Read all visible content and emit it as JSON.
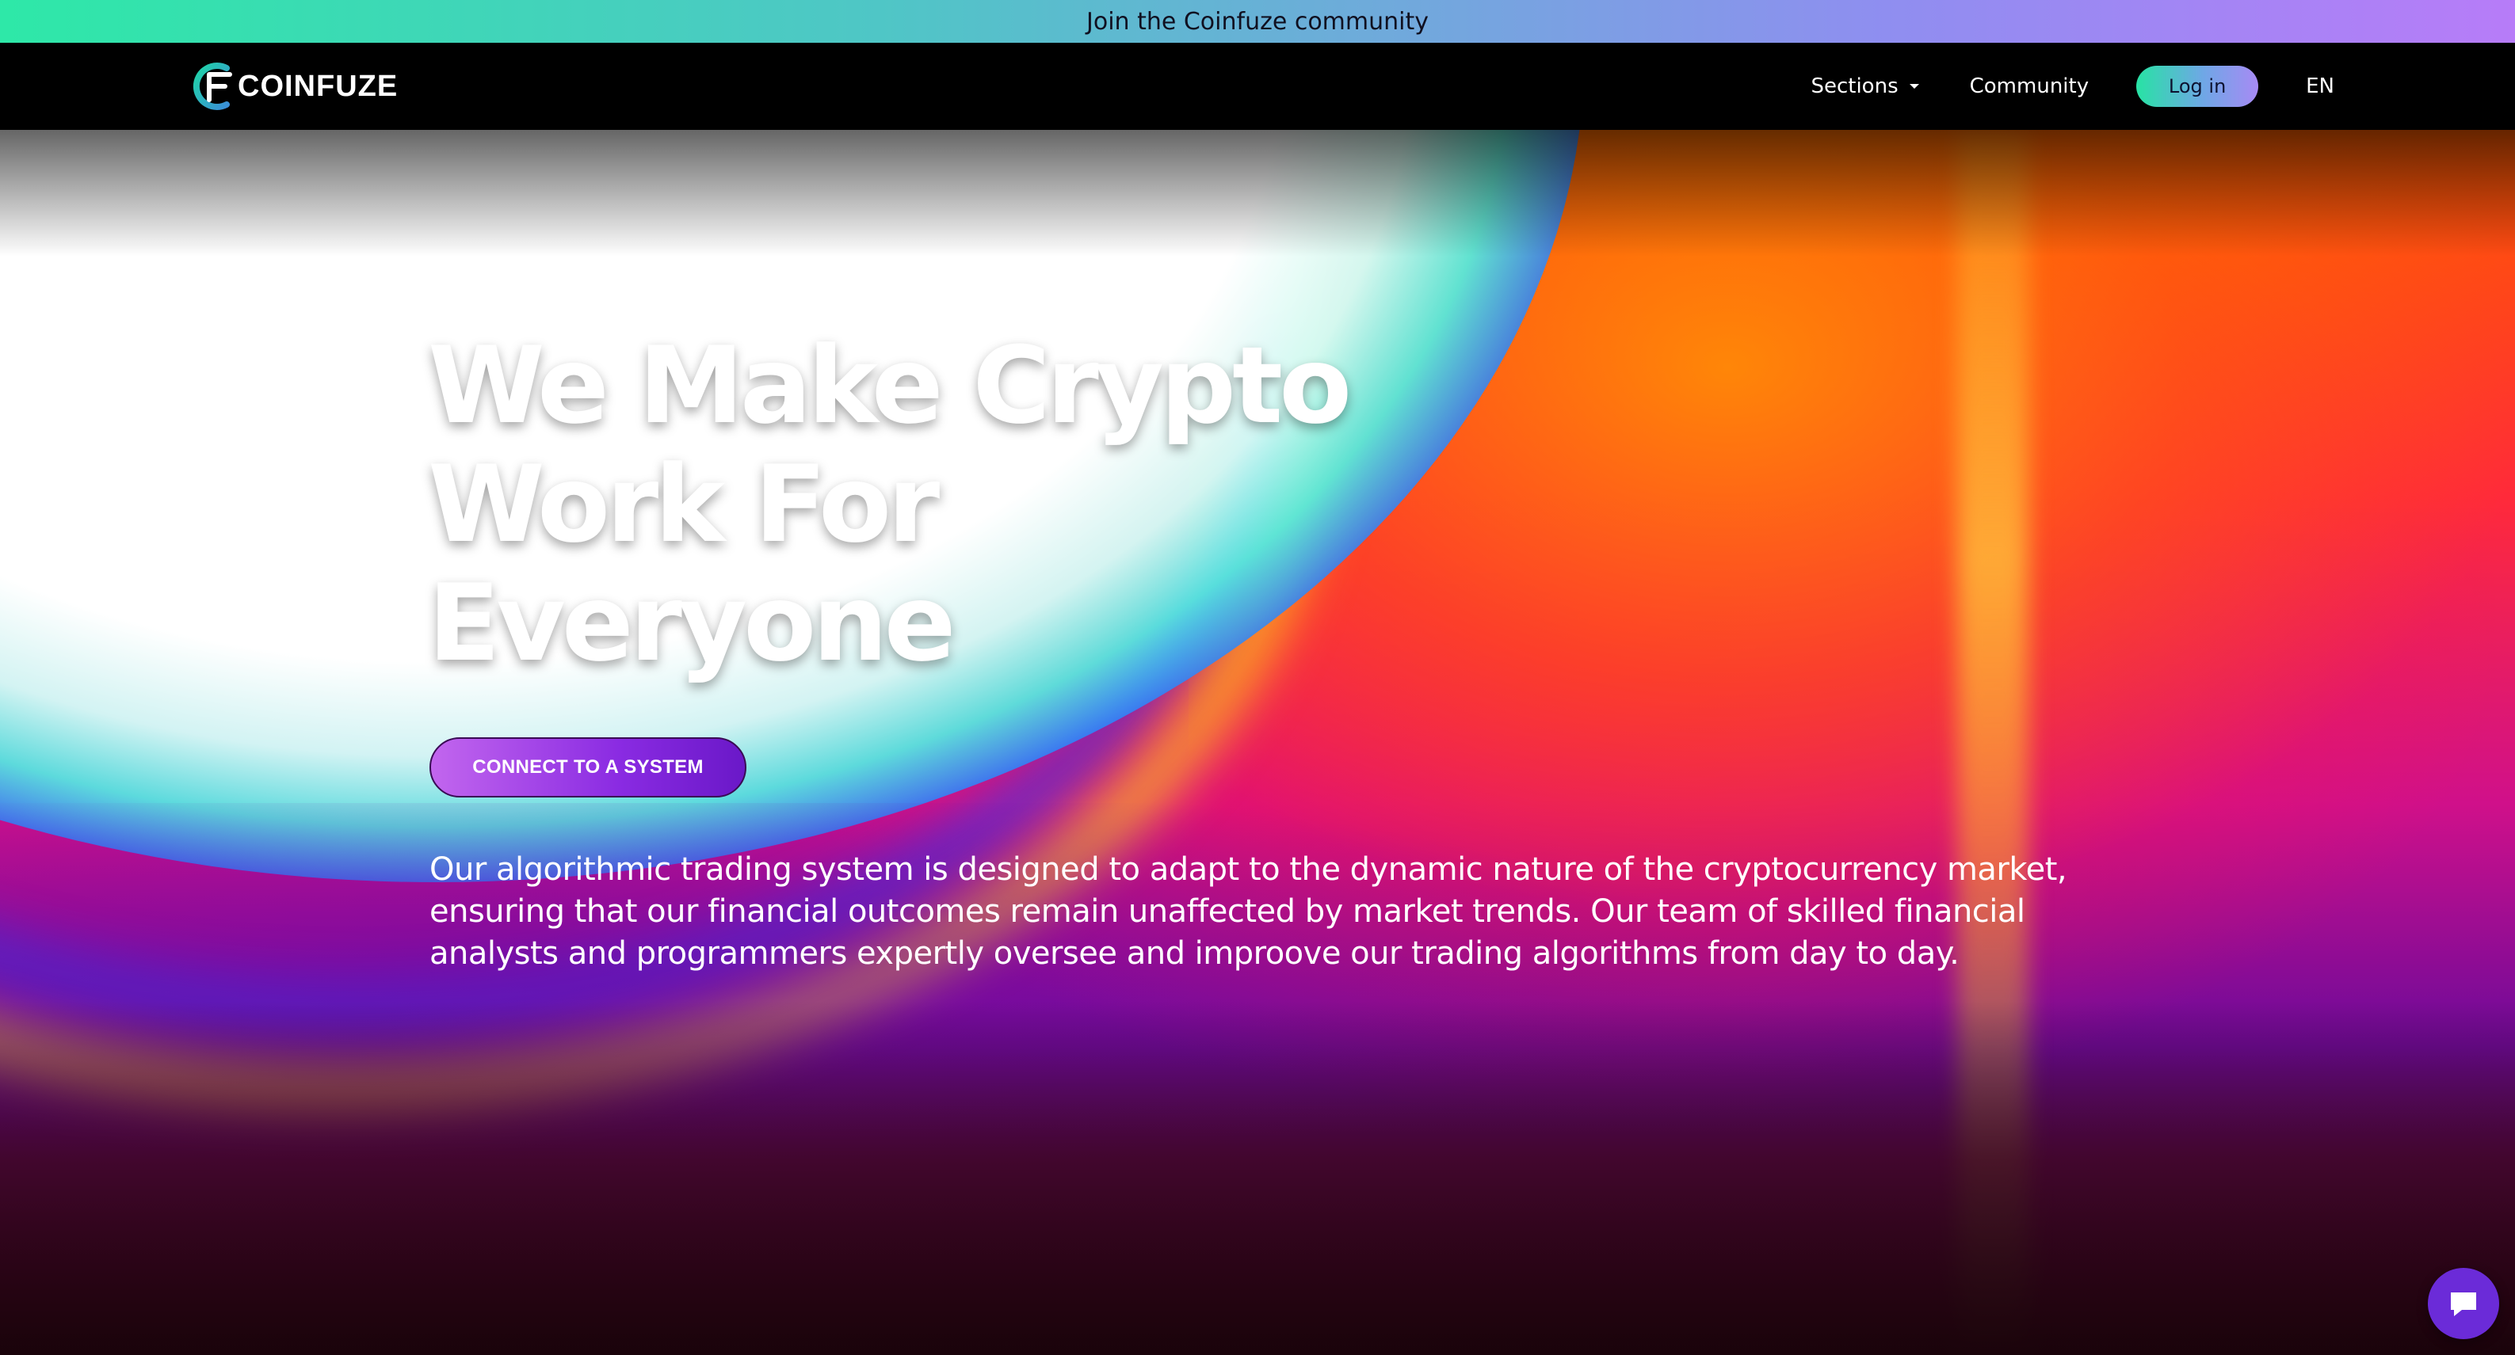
{
  "banner": {
    "text": "Join the Coinfuze community"
  },
  "navbar": {
    "logo_text": "COINFUZE",
    "sections_label": "Sections",
    "community_label": "Community",
    "login_label": "Log in",
    "language": "EN"
  },
  "hero": {
    "title_line1": "We Make Crypto",
    "title_line2": "Work For",
    "title_line3": "Everyone",
    "cta_label": "CONNECT TO A SYSTEM",
    "description": "Our algorithmic trading system is designed to adapt to the dynamic nature of the cryptocurrency market, ensuring that our financial outcomes remain unaffected by market trends. Our team of skilled financial analysts and programmers expertly oversee and improove our trading algorithms from day to day."
  },
  "icons": {
    "logo": "coinfuze-logo-icon",
    "sections_caret": "chevron-down-icon",
    "chat": "chat-icon"
  },
  "colors": {
    "banner_gradient_start": "#2ee8a8",
    "banner_gradient_end": "#b77cf8",
    "login_gradient_start": "#27e3a4",
    "login_gradient_end": "#a78af4",
    "cta_gradient_start": "#c266ee",
    "cta_gradient_end": "#6a18c8",
    "chat_button": "#6b2bd8"
  }
}
